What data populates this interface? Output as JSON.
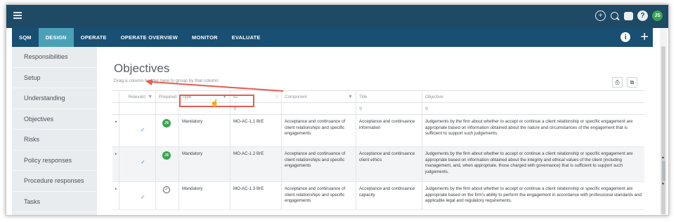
{
  "topbar": {
    "avatar_initials": "JS",
    "help": "?"
  },
  "nav": {
    "tabs": [
      "SQM",
      "DESIGN",
      "OPERATE",
      "OPERATE OVERVIEW",
      "MONITOR",
      "EVALUATE"
    ],
    "active": "DESIGN",
    "info": "i",
    "plus": "+"
  },
  "sidebar": {
    "items": [
      "Responsibilities",
      "Setup",
      "Understanding",
      "Objectives",
      "Risks",
      "Policy responses",
      "Procedure responses",
      "Tasks"
    ]
  },
  "main": {
    "title": "Objectives",
    "group_hint": "Drag a column header here to group by that column"
  },
  "grid": {
    "headers": [
      "Relevant",
      "Prepared",
      "Type",
      "ID",
      "Component",
      "Title",
      "Objective"
    ],
    "rows": [
      {
        "prepared": "JS",
        "type": "Mandatory",
        "id": "MO-AC-1.1 BrE",
        "component": "Acceptance and continuance of client relationships and specific engagements",
        "title": "Acceptance and continuance information",
        "objective": "Judgements by the firm about whether to accept or continue a client relationship or specific engagement are appropriate based on information obtained about the nature and circumstances of the engagement that is sufficient to support such judgements."
      },
      {
        "prepared": "JS",
        "type": "Mandatory",
        "id": "MO-AC-1.2 BrE",
        "component": "Acceptance and continuance of client relationships and specific engagements",
        "title": "Acceptance and continuance client ethics",
        "objective": "Judgements by the firm about whether to accept or continue a client relationship or specific engagement are appropriate based on information obtained about the integrity and ethical values of the client (including management, and, when appropriate, those charged with governance) that is sufficient to support such judgements."
      },
      {
        "prepared": "",
        "type": "Mandatory",
        "id": "MO-AC-1.3 BrE",
        "component": "Acceptance and continuance of client relationships and specific engagements",
        "title": "Acceptance and continuance capacity",
        "objective": "Judgements by the firm about whether to accept or continue a client relationship or specific engagement are appropriate based on the firm's ability to perform the engagement in accordance with professional standards and applicable legal and regulatory requirements."
      }
    ]
  },
  "colors": {
    "topbar": "#1e4a66",
    "navbar": "#184f73",
    "active_tab": "#4aa1b7",
    "annotation": "#e65c4f",
    "avatar": "#3aa351"
  }
}
